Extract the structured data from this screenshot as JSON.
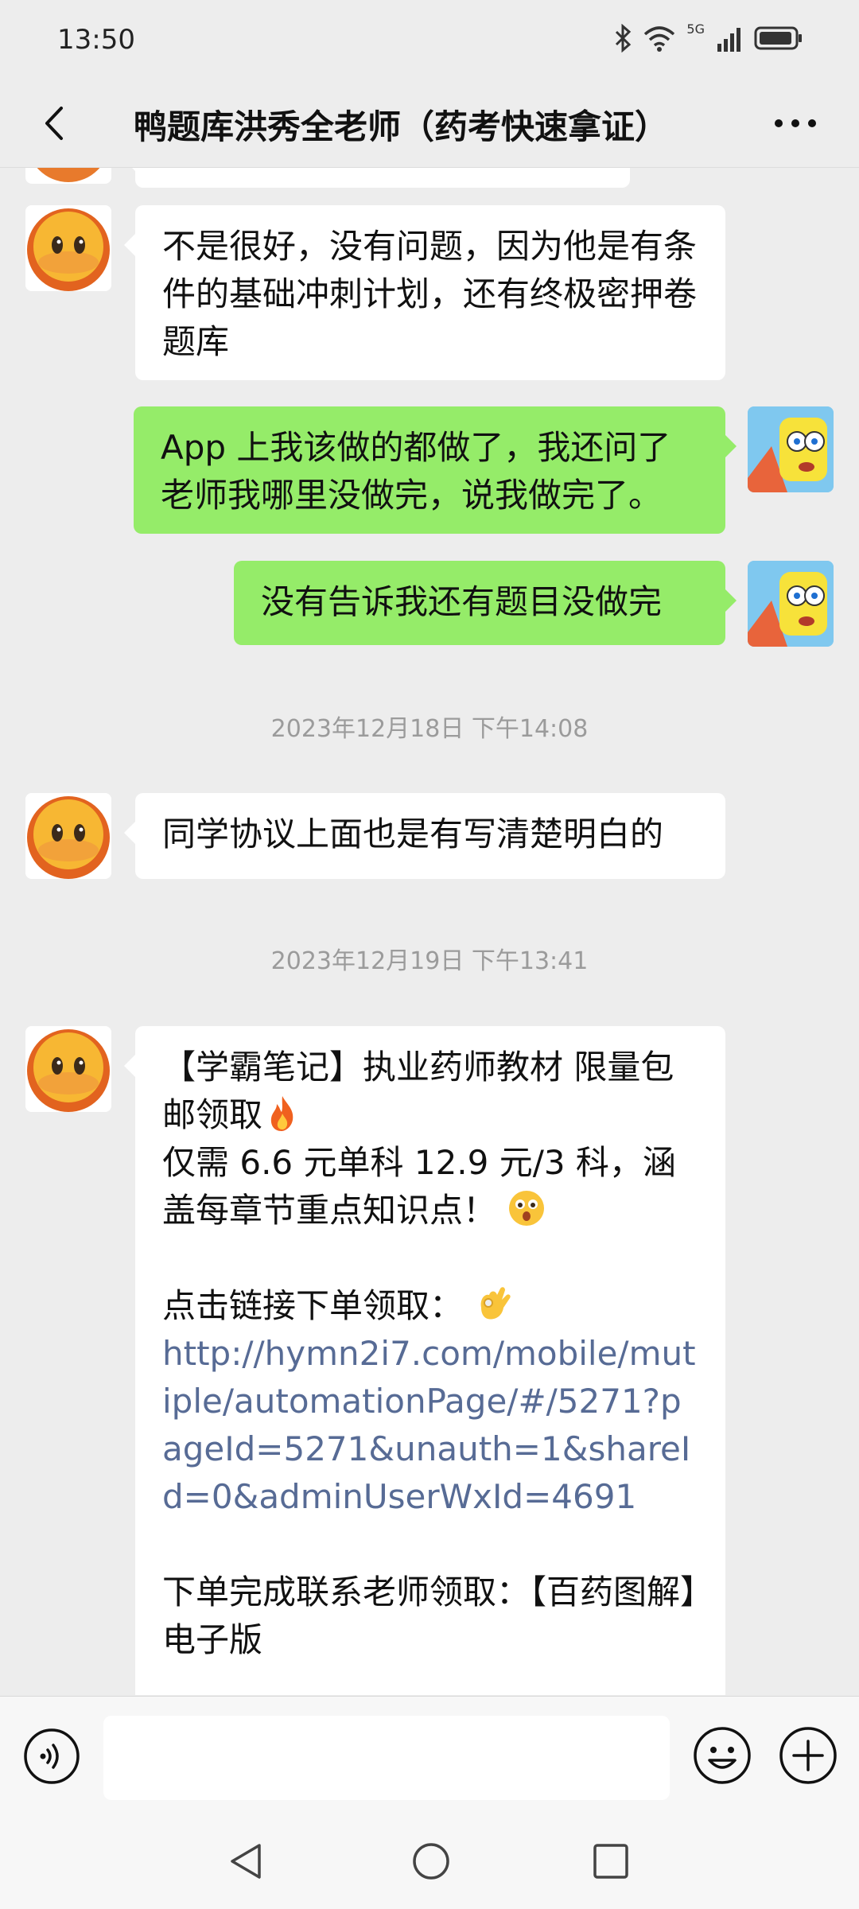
{
  "status": {
    "time": "13:50",
    "network": "5G"
  },
  "header": {
    "title": "鸭题库洪秀全老师（药考快速拿证）"
  },
  "messages": {
    "m1": "不是很好，没有问题，因为他是有条件的基础冲刺计划，还有终极密押卷题库",
    "m2": "App 上我该做的都做了，我还问了老师我哪里没做完，说我做完了。",
    "m3": "没有告诉我还有题目没做完",
    "ts1": "2023年12月18日 下午14:08",
    "m4": "同学协议上面也是有写清楚明白的",
    "ts2": "2023年12月19日 下午13:41",
    "m5": {
      "p1": "【学霸笔记】执业药师教材 限量包邮领取",
      "p2": "仅需 6.6 元单科 12.9 元/3 科，涵盖每章节重点知识点！",
      "p3": "点击链接下单领取：",
      "link": "http://hymn2i7.com/mobile/mutiple/automationPage/#/5271?pageId=5271&unauth=1&shareId=0&adminUserWxId=4691",
      "p4": "下单完成联系老师领取：【百药图解】电子版"
    }
  },
  "icons": {
    "back": "chevron-left-icon",
    "more": "more-dots-icon",
    "voice": "voice-icon",
    "emoji": "emoji-icon",
    "plus": "plus-icon"
  },
  "colors": {
    "sent_bubble": "#95ec69",
    "received_bubble": "#ffffff",
    "link": "#576b95",
    "background": "#ededed"
  }
}
